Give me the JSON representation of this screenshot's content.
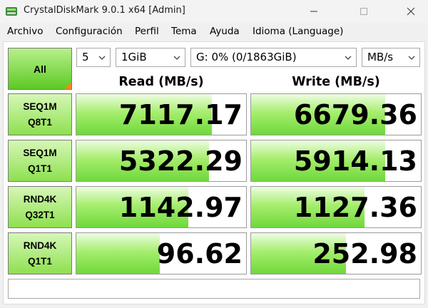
{
  "window": {
    "title": "CrystalDiskMark 9.0.1 x64 [Admin]"
  },
  "menu": [
    "Archivo",
    "Configuración",
    "Perfil",
    "Tema",
    "Ayuda",
    "Idioma (Language)"
  ],
  "controls": {
    "all_label": "All",
    "count": "5",
    "size": "1GiB",
    "drive": "G: 0% (0/1863GiB)",
    "unit": "MB/s"
  },
  "headers": {
    "read": "Read (MB/s)",
    "write": "Write (MB/s)"
  },
  "tests": [
    {
      "line1": "SEQ1M",
      "line2": "Q8T1",
      "read": "7117.17",
      "write": "6679.36",
      "read_fill": 0.8,
      "write_fill": 0.79
    },
    {
      "line1": "SEQ1M",
      "line2": "Q1T1",
      "read": "5322.29",
      "write": "5914.13",
      "read_fill": 0.78,
      "write_fill": 0.79
    },
    {
      "line1": "RND4K",
      "line2": "Q32T1",
      "read": "1142.97",
      "write": "1127.36",
      "read_fill": 0.66,
      "write_fill": 0.67
    },
    {
      "line1": "RND4K",
      "line2": "Q1T1",
      "read": "96.62",
      "write": "252.98",
      "read_fill": 0.49,
      "write_fill": 0.56
    }
  ],
  "comment": "",
  "colors": {
    "accent_green": "#6fd83a",
    "corner_orange": "#f08a1c"
  }
}
